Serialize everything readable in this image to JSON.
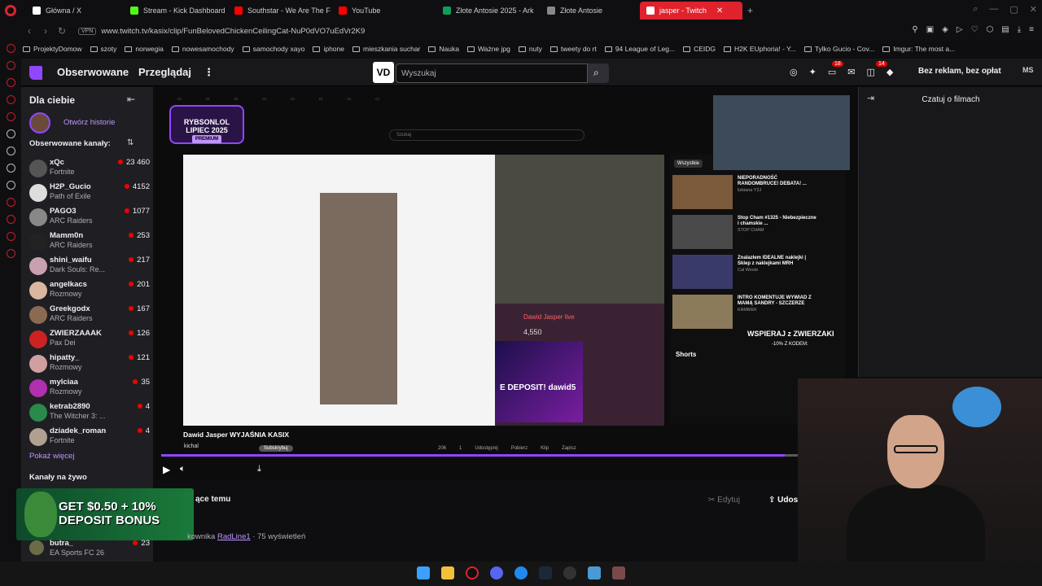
{
  "browser": {
    "tabs": [
      {
        "label": "Główna / X",
        "color": "#ffffff"
      },
      {
        "label": "Stream - Kick Dashboard",
        "color": "#53fc18"
      },
      {
        "label": "Southstar - We Are The F",
        "color": "#ff0000"
      },
      {
        "label": "YouTube",
        "color": "#ff0000"
      },
      {
        "label": "Złote Antosie 2025 - Ark",
        "color": "#0f9d58"
      },
      {
        "label": "Złote Antosie",
        "color": "#888888"
      },
      {
        "label": "jasper - Twitch",
        "color": "#9147ff"
      }
    ],
    "vpn_label": "VPN",
    "url": "www.twitch.tv/kasix/clip/FunBelovedChickenCeilingCat-NuP0dVO7uEdVr2K9",
    "bookmarks": [
      "ProjektyDomow",
      "szoty",
      "norwegia",
      "nowesamochody",
      "samochody xayo",
      "iphone",
      "mieszkania suchar",
      "Nauka",
      "Ważne jpg",
      "nuty",
      "tweety do rt",
      "94 League of Leg...",
      "CEIDG",
      "H2K EUphoria! - Y...",
      "Tylko Gucio - Cov...",
      "Imgur: The most a..."
    ]
  },
  "twitch_header": {
    "following": "Obserwowane",
    "browse": "Przeglądaj",
    "search_placeholder": "Wyszukaj",
    "vd_logo": "VD",
    "ad_free": "Bez reklam, bez opłat",
    "badge1": "18",
    "badge2": "14",
    "profile": "MS"
  },
  "sidebar": {
    "title": "Dla ciebie",
    "story": "Otwórz historie",
    "followed_title": "Obserwowane kanały:",
    "channels": [
      {
        "name": "xQc",
        "game": "Fortnite",
        "viewers": "23 460",
        "color": "#555"
      },
      {
        "name": "H2P_Gucio",
        "game": "Path of Exile",
        "viewers": "4152",
        "color": "#ddd"
      },
      {
        "name": "PAGO3",
        "game": "ARC Raiders",
        "viewers": "1077",
        "color": "#888"
      },
      {
        "name": "Mamm0n",
        "game": "ARC Raiders",
        "viewers": "253",
        "color": "#222"
      },
      {
        "name": "shini_waifu",
        "game": "Dark Souls: Re...",
        "viewers": "217",
        "color": "#c9a0b0"
      },
      {
        "name": "angelkacs",
        "game": "Rozmowy",
        "viewers": "201",
        "color": "#d9b7a0"
      },
      {
        "name": "Greekgodx",
        "game": "ARC Raiders",
        "viewers": "167",
        "color": "#8a6a50"
      },
      {
        "name": "ZWIERZAAAK",
        "game": "Pax Dei",
        "viewers": "126",
        "color": "#cc2222"
      },
      {
        "name": "hipatty_",
        "game": "Rozmowy",
        "viewers": "121",
        "color": "#d0a0a0"
      },
      {
        "name": "mylciaa",
        "game": "Rozmowy",
        "viewers": "35",
        "color": "#b030b0"
      },
      {
        "name": "ketrab2890",
        "game": "The Witcher 3: ...",
        "viewers": "4",
        "color": "#2a8a4a"
      },
      {
        "name": "dziadek_roman",
        "game": "Fortnite",
        "viewers": "4",
        "color": "#b0a090"
      }
    ],
    "show_more": "Pokaż więcej",
    "live_title": "Kanały na żywo",
    "bottom_channel": {
      "name": "butra_",
      "game": "EA Sports FC 26",
      "viewers": "23"
    }
  },
  "video": {
    "overlay_badge_line1": "RYBSONLOL",
    "overlay_badge_line2": "LIPIEC 2025",
    "overlay_badge_line3": "PREMIUM",
    "inner_search": "Szukaj",
    "donation_name": "Dawid Jasper live",
    "donation_amount": "4,550",
    "stake_text": "E DEPOSIT! dawid5",
    "yt_chip": "Wszystkie",
    "yt_videos": [
      {
        "title": "NIEPORADNOŚĆ RANDOMBRUCE! DEBATA! ...",
        "channel": "lizkiana Y2J"
      },
      {
        "title": "Stop Cham #1325 - Niebezpieczne i chamskie ...",
        "channel": "STOP CHAM"
      },
      {
        "title": "Znalazłem IDEALNE naklejki | Sklep z naklejkami MRH",
        "channel": "Cal Weste"
      },
      {
        "title": "INTRO KOMENTUJE WYWIAD Z MAMĄ SANDRY - SZCZERZE",
        "channel": "KAMMEK"
      }
    ],
    "shorts_label": "Shorts",
    "wspieraj": "WSPIERAJ z ZWIERZAKI",
    "wspieraj2": "-10% Z KODEM:",
    "title": "Dawid Jasper WYJAŚNIA KASIX",
    "channel": "kichal",
    "subscribe": "Subskrybuj",
    "actions": [
      "206",
      "1",
      "Udostępnij",
      "Pobierz",
      "Klip",
      "Zapisz"
    ],
    "progress_percent": 98
  },
  "chat": {
    "title": "Czatuj o filmach"
  },
  "below": {
    "ad_text_line1": "GET $0.50 + 10%",
    "ad_text_line2": "DEPOSIT BONUS",
    "related": "ące temu",
    "edit": "Edytuj",
    "share": "Udos",
    "meta_prefix": "kownika",
    "meta_user": "RadLine1",
    "meta_suffix": " · 75 wyświetleń"
  }
}
